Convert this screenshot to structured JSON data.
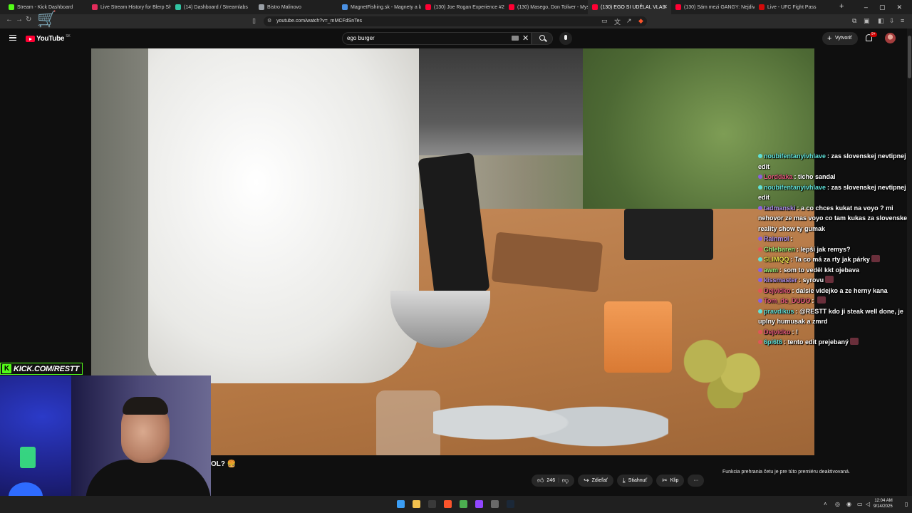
{
  "browser": {
    "tabs": [
      {
        "label": "Stream - Kick Dashboard",
        "color": "#53fc18"
      },
      {
        "label": "Live Stream History for Blerp Share",
        "color": "#e22c5b"
      },
      {
        "label": "(14) Dashboard / Streamlabs",
        "color": "#31c3a2"
      },
      {
        "label": "Bistro Malinovo",
        "color": "#9aa0a6"
      },
      {
        "label": "MagnetFishing.sk - Magnety a lano",
        "color": "#4a90e2"
      },
      {
        "label": "(130) Joe Rogan Experience #2374",
        "color": "#ff0033"
      },
      {
        "label": "(130) Masego, Don Toliver - Mystery",
        "color": "#ff0033"
      },
      {
        "label": "(130) EGO SI UDĚLAL VLAS",
        "color": "#ff0033"
      },
      {
        "label": "(130) Sám mezi GANGY: Nejdivočej",
        "color": "#ff0033"
      },
      {
        "label": "Live - UFC Fight Pass",
        "color": "#d20a0a"
      }
    ],
    "new_tab": "+",
    "window_controls": [
      "–",
      "▢",
      "✕"
    ],
    "url": "youtube.com/watch?v=_mMCFdSnTes"
  },
  "youtube": {
    "logo": "YouTube",
    "country": "SK",
    "search_value": "ego burger",
    "create_label": "Vytvoriť",
    "notifications": "9+"
  },
  "overlay": {
    "kick_label": "KICK.COM/RESTT",
    "kick_k": "K"
  },
  "chat": [
    {
      "user": "noubifentanyivhlave",
      "color": "#5fe0d8",
      "dot": "#5fe0d8",
      "text": "zas slovenskej nevtipnej edit"
    },
    {
      "user": "Lorddaka",
      "color": "#e0567a",
      "dot": "#8a5fe0",
      "text": "ticho sandal"
    },
    {
      "user": "noubifentanyivhlave",
      "color": "#5fe0d8",
      "dot": "#5fe0d8",
      "text": "zas slovenskej nevtipnej edit"
    },
    {
      "user": "tadmanski",
      "color": "#a98be8",
      "dot": "#8a5fe0",
      "text": "a co chces kukat na voyo ? mi nehovor ze mas voyo co tam kukas za slovenske reality show ty gumak"
    },
    {
      "user": "Rainmol",
      "color": "#a98be8",
      "dot": "#8a5fe0",
      "text": ""
    },
    {
      "user": "Chlebaren",
      "color": "#9cf27a",
      "dot": "#e05656",
      "text": "lepší jak remys?"
    },
    {
      "user": "SLIMQQ",
      "color": "#e8e34a",
      "dot": "#5fe0d8",
      "text": "Ta co má za rty jak párky"
    },
    {
      "user": "awm",
      "color": "#9cf27a",
      "dot": "#8a5fe0",
      "text": "som to veděl kkt ojebava"
    },
    {
      "user": "kissmaster",
      "color": "#a98be8",
      "dot": "#8a5fe0",
      "text": "syrovu"
    },
    {
      "user": "Dejvidko",
      "color": "#e0567a",
      "dot": "#e05656",
      "text": "dalsie videjko a ze herny kana"
    },
    {
      "user": "Tom_de_DUDO",
      "color": "#e0567a",
      "dot": "#8a5fe0",
      "text": ""
    },
    {
      "user": "pravdikus",
      "color": "#5fe0d8",
      "dot": "#5fe0d8",
      "text": "@RESTT kdo ji steak well done, je uplny humusak a zmrd"
    },
    {
      "user": "Dejvidko",
      "color": "#e0567a",
      "dot": "#e05656",
      "text": "!"
    },
    {
      "user": "6pi6t6",
      "color": "#5fe0d8",
      "dot": "#e05656",
      "text": "tento edit prejebaný"
    }
  ],
  "video": {
    "title_fragment": "OL? 🍔",
    "like_count": "246",
    "share_label": "Zdieľať",
    "download_label": "Stiahnuť",
    "clip_label": "Klip",
    "more_label": "···",
    "chat_disabled": "Funkcia prehrania četu je pre túto premiéru deaktivovaná."
  },
  "taskbar": {
    "icons": [
      {
        "name": "windows-start-icon",
        "color": "#3b9ef5"
      },
      {
        "name": "file-explorer-icon",
        "color": "#f2c14e"
      },
      {
        "name": "terminal-icon",
        "color": "#3a3a3a"
      },
      {
        "name": "brave-icon",
        "color": "#fb542b"
      },
      {
        "name": "chrome-icon",
        "color": "#4caf50"
      },
      {
        "name": "twitch-icon",
        "color": "#9146ff"
      },
      {
        "name": "obs-icon",
        "color": "#6a6a6a"
      },
      {
        "name": "steam-icon",
        "color": "#1b2838"
      }
    ],
    "time": "12:04 AM",
    "date": "9/14/2025"
  }
}
